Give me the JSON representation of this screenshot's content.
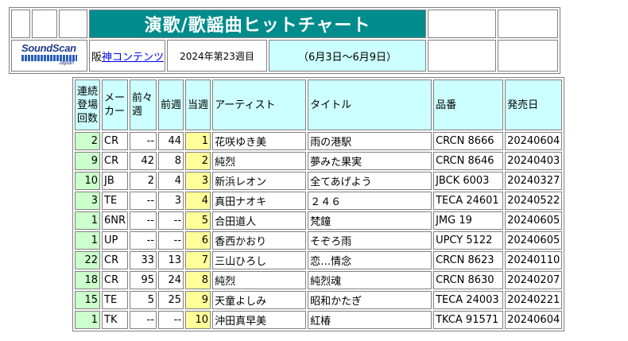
{
  "header": {
    "title": "演歌/歌謡曲ヒットチャート",
    "logo": {
      "brand": "SoundScan",
      "sub": "Japan"
    },
    "company_prefix": "阪",
    "company_link": "神コンテンツ",
    "week": "2024年第23週目",
    "range": "（6月3日～6月9日）"
  },
  "columns": {
    "streak": "連続登場回数",
    "maker": "メーカー",
    "prev2": "前々週",
    "prev": "前週",
    "current": "当週",
    "artist": "アーティスト",
    "title": "タイトル",
    "catalog": "品番",
    "release": "発売日"
  },
  "rows": [
    {
      "streak": "2",
      "maker": "CR",
      "prev2": "--",
      "prev": "44",
      "current": "1",
      "artist": "花咲ゆき美",
      "title": "雨の港駅",
      "catalog": "CRCN 8666",
      "release": "20240604"
    },
    {
      "streak": "9",
      "maker": "CR",
      "prev2": "42",
      "prev": "8",
      "current": "2",
      "artist": "純烈",
      "title": "夢みた果実",
      "catalog": "CRCN 8646",
      "release": "20240403"
    },
    {
      "streak": "10",
      "maker": "JB",
      "prev2": "2",
      "prev": "4",
      "current": "3",
      "artist": "新浜レオン",
      "title": "全てあげよう",
      "catalog": "JBCK 6003",
      "release": "20240327"
    },
    {
      "streak": "3",
      "maker": "TE",
      "prev2": "--",
      "prev": "3",
      "current": "4",
      "artist": "真田ナオキ",
      "title": "２４６",
      "catalog": "TECA 24601",
      "release": "20240522"
    },
    {
      "streak": "1",
      "maker": "6NR",
      "prev2": "--",
      "prev": "--",
      "current": "5",
      "artist": "合田道人",
      "title": "梵鐘",
      "catalog": "JMG 19",
      "release": "20240605"
    },
    {
      "streak": "1",
      "maker": "UP",
      "prev2": "--",
      "prev": "--",
      "current": "6",
      "artist": "香西かおり",
      "title": "そぞろ雨",
      "catalog": "UPCY 5122",
      "release": "20240605"
    },
    {
      "streak": "22",
      "maker": "CR",
      "prev2": "33",
      "prev": "13",
      "current": "7",
      "artist": "三山ひろし",
      "title": "恋…情念",
      "catalog": "CRCN 8623",
      "release": "20240110"
    },
    {
      "streak": "18",
      "maker": "CR",
      "prev2": "95",
      "prev": "24",
      "current": "8",
      "artist": "純烈",
      "title": "純烈魂",
      "catalog": "CRCN 8630",
      "release": "20240207"
    },
    {
      "streak": "15",
      "maker": "TE",
      "prev2": "5",
      "prev": "25",
      "current": "9",
      "artist": "天童よしみ",
      "title": "昭和かたぎ",
      "catalog": "TECA 24003",
      "release": "20240221"
    },
    {
      "streak": "1",
      "maker": "TK",
      "prev2": "--",
      "prev": "--",
      "current": "10",
      "artist": "沖田真早美",
      "title": "紅椿",
      "catalog": "TKCA 91571",
      "release": "20240604"
    }
  ]
}
